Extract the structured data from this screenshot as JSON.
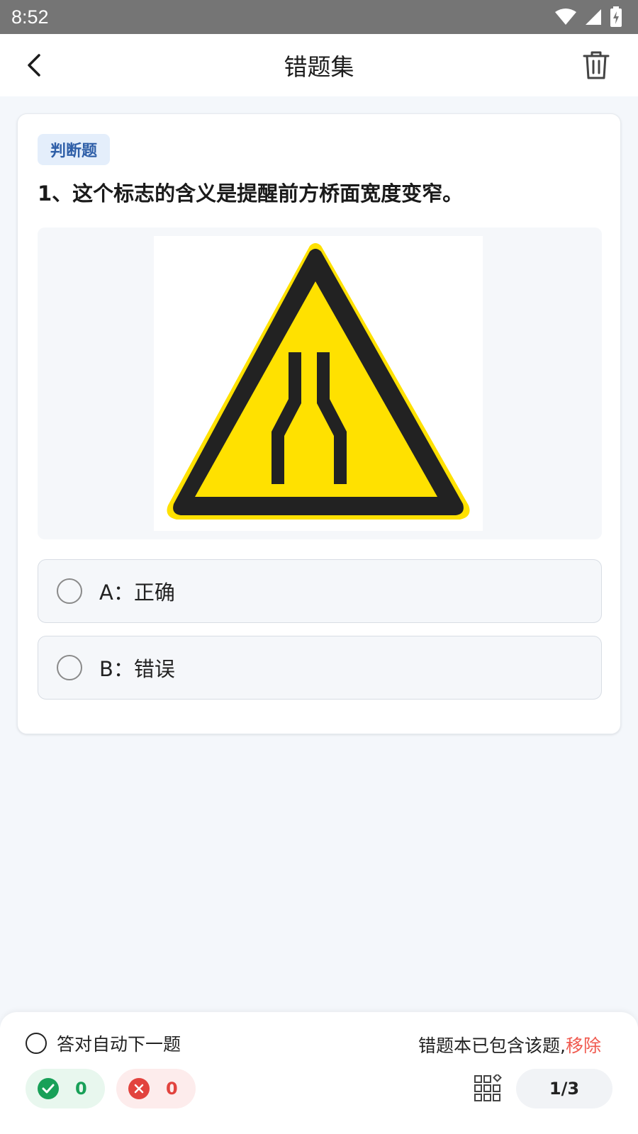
{
  "status_bar": {
    "time": "8:52"
  },
  "header": {
    "title": "错题集"
  },
  "question": {
    "type_badge": "判断题",
    "text": "1、这个标志的含义是提醒前方桥面宽度变窄。",
    "options": [
      {
        "label": "A：正确"
      },
      {
        "label": "B：错误"
      }
    ]
  },
  "bottom": {
    "auto_next_label": "答对自动下一题",
    "contains_text": "错题本已包含该题,",
    "remove_label": "移除",
    "correct_count": "0",
    "wrong_count": "0",
    "page_indicator": "1/3"
  },
  "colors": {
    "accent_blue": "#2f5fa8",
    "correct_green": "#18a058",
    "wrong_red": "#e2433e",
    "remove_red": "#f05a4f",
    "sign_yellow": "#ffe100",
    "sign_black": "#222222"
  },
  "icons": {
    "back": "chevron-left-icon",
    "trash": "trash-icon",
    "wifi": "wifi-icon",
    "signal": "signal-icon",
    "battery": "battery-charging-icon",
    "check": "check-circle-icon",
    "wrong": "x-circle-icon",
    "grid": "grid-icon"
  }
}
